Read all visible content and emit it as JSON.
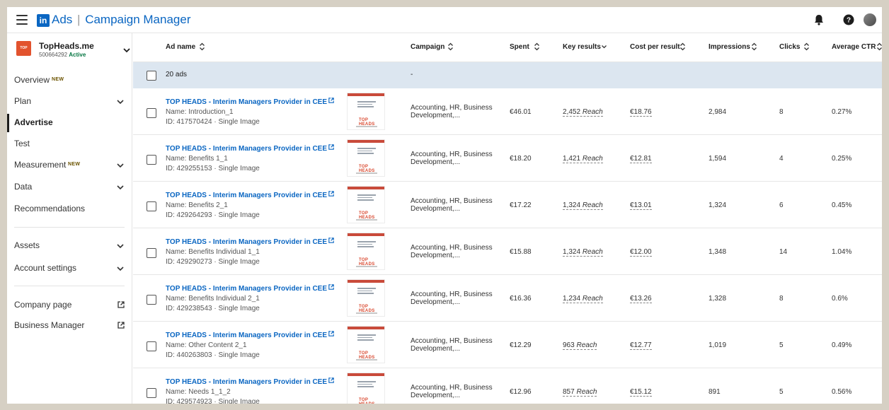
{
  "topbar": {
    "brand_ads": "Ads",
    "brand_separator": "|",
    "brand_product": "Campaign Manager",
    "logo_text": "in",
    "icons": [
      "menu-icon",
      "bell-icon",
      "help-icon",
      "avatar"
    ]
  },
  "account": {
    "name": "TopHeads.me",
    "id": "500664292",
    "status": "Active",
    "logo_text": "TOP HEADS"
  },
  "sidebar": {
    "overview": "Overview",
    "overview_badge": "NEW",
    "plan": "Plan",
    "advertise": "Advertise",
    "test": "Test",
    "measurement": "Measurement",
    "measurement_badge": "NEW",
    "data": "Data",
    "recommendations": "Recommendations",
    "assets": "Assets",
    "account_settings": "Account settings",
    "company_page": "Company page",
    "business_manager": "Business Manager"
  },
  "table": {
    "headers": {
      "ad_name": "Ad name",
      "campaign": "Campaign",
      "spent": "Spent",
      "key_results": "Key results",
      "cost_per_result": "Cost per result",
      "impressions": "Impressions",
      "clicks": "Clicks",
      "avg_ctr": "Average CTR"
    },
    "summary": {
      "count": "20 ads",
      "campaign": "-"
    },
    "rows": [
      {
        "title": "TOP HEADS - Interim Managers Provider in CEE",
        "name": "Name: Introduction_1",
        "id": "ID: 417570424 · Single Image",
        "campaign": "Accounting, HR, Business Development,...",
        "spent": "€46.01",
        "key_value": "2,452",
        "key_unit": "Reach",
        "cost": "€18.76",
        "impressions": "2,984",
        "clicks": "8",
        "ctr": "0.27%"
      },
      {
        "title": "TOP HEADS - Interim Managers Provider in CEE",
        "name": "Name: Benefits 1_1",
        "id": "ID: 429255153 · Single Image",
        "campaign": "Accounting, HR, Business Development,...",
        "spent": "€18.20",
        "key_value": "1,421",
        "key_unit": "Reach",
        "cost": "€12.81",
        "impressions": "1,594",
        "clicks": "4",
        "ctr": "0.25%"
      },
      {
        "title": "TOP HEADS - Interim Managers Provider in CEE",
        "name": "Name: Benefits 2_1",
        "id": "ID: 429264293 · Single Image",
        "campaign": "Accounting, HR, Business Development,...",
        "spent": "€17.22",
        "key_value": "1,324",
        "key_unit": "Reach",
        "cost": "€13.01",
        "impressions": "1,324",
        "clicks": "6",
        "ctr": "0.45%"
      },
      {
        "title": "TOP HEADS - Interim Managers Provider in CEE",
        "name": "Name: Benefits Individual 1_1",
        "id": "ID: 429290273 · Single Image",
        "campaign": "Accounting, HR, Business Development,...",
        "spent": "€15.88",
        "key_value": "1,324",
        "key_unit": "Reach",
        "cost": "€12.00",
        "impressions": "1,348",
        "clicks": "14",
        "ctr": "1.04%"
      },
      {
        "title": "TOP HEADS - Interim Managers Provider in CEE",
        "name": "Name: Benefits Individual 2_1",
        "id": "ID: 429238543 · Single Image",
        "campaign": "Accounting, HR, Business Development,...",
        "spent": "€16.36",
        "key_value": "1,234",
        "key_unit": "Reach",
        "cost": "€13.26",
        "impressions": "1,328",
        "clicks": "8",
        "ctr": "0.6%"
      },
      {
        "title": "TOP HEADS - Interim Managers Provider in CEE",
        "name": "Name: Other Content 2_1",
        "id": "ID: 440263803 · Single Image",
        "campaign": "Accounting, HR, Business Development,...",
        "spent": "€12.29",
        "key_value": "963",
        "key_unit": "Reach",
        "cost": "€12.77",
        "impressions": "1,019",
        "clicks": "5",
        "ctr": "0.49%"
      },
      {
        "title": "TOP HEADS - Interim Managers Provider in CEE",
        "name": "Name: Needs 1_1_2",
        "id": "ID: 429574923 · Single Image",
        "campaign": "Accounting, HR, Business Development,...",
        "spent": "€12.96",
        "key_value": "857",
        "key_unit": "Reach",
        "cost": "€15.12",
        "impressions": "891",
        "clicks": "5",
        "ctr": "0.56%"
      }
    ],
    "thumbnail_logo": "TOP HEADS"
  },
  "colors": {
    "brand_blue": "#0a66c2",
    "summary_row_bg": "#dce6f0",
    "active_green": "#057642",
    "company_orange": "#e2532e"
  }
}
